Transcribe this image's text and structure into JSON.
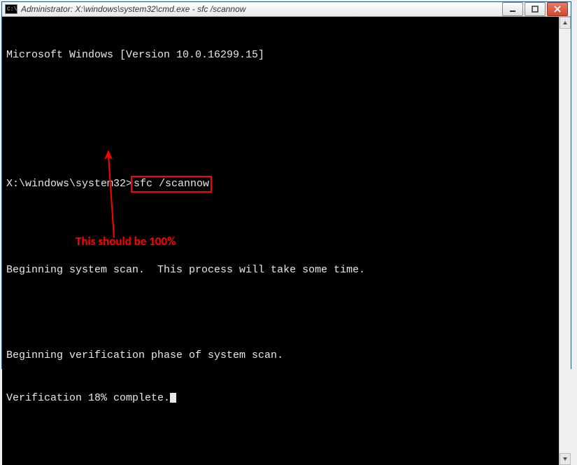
{
  "window": {
    "title": "Administrator: X:\\windows\\system32\\cmd.exe - sfc  /scannow",
    "icon_text": "C:\\."
  },
  "terminal": {
    "line1": "Microsoft Windows [Version 10.0.16299.15]",
    "prompt": "X:\\windows\\system32>",
    "command": "sfc /scannow",
    "line3": "Beginning system scan.  This process will take some time.",
    "line4": "Beginning verification phase of system scan.",
    "line5_prefix": "Verification ",
    "line5_percent": "18%",
    "line5_suffix": " complete."
  },
  "annotation": {
    "text": "This should be 100%"
  }
}
